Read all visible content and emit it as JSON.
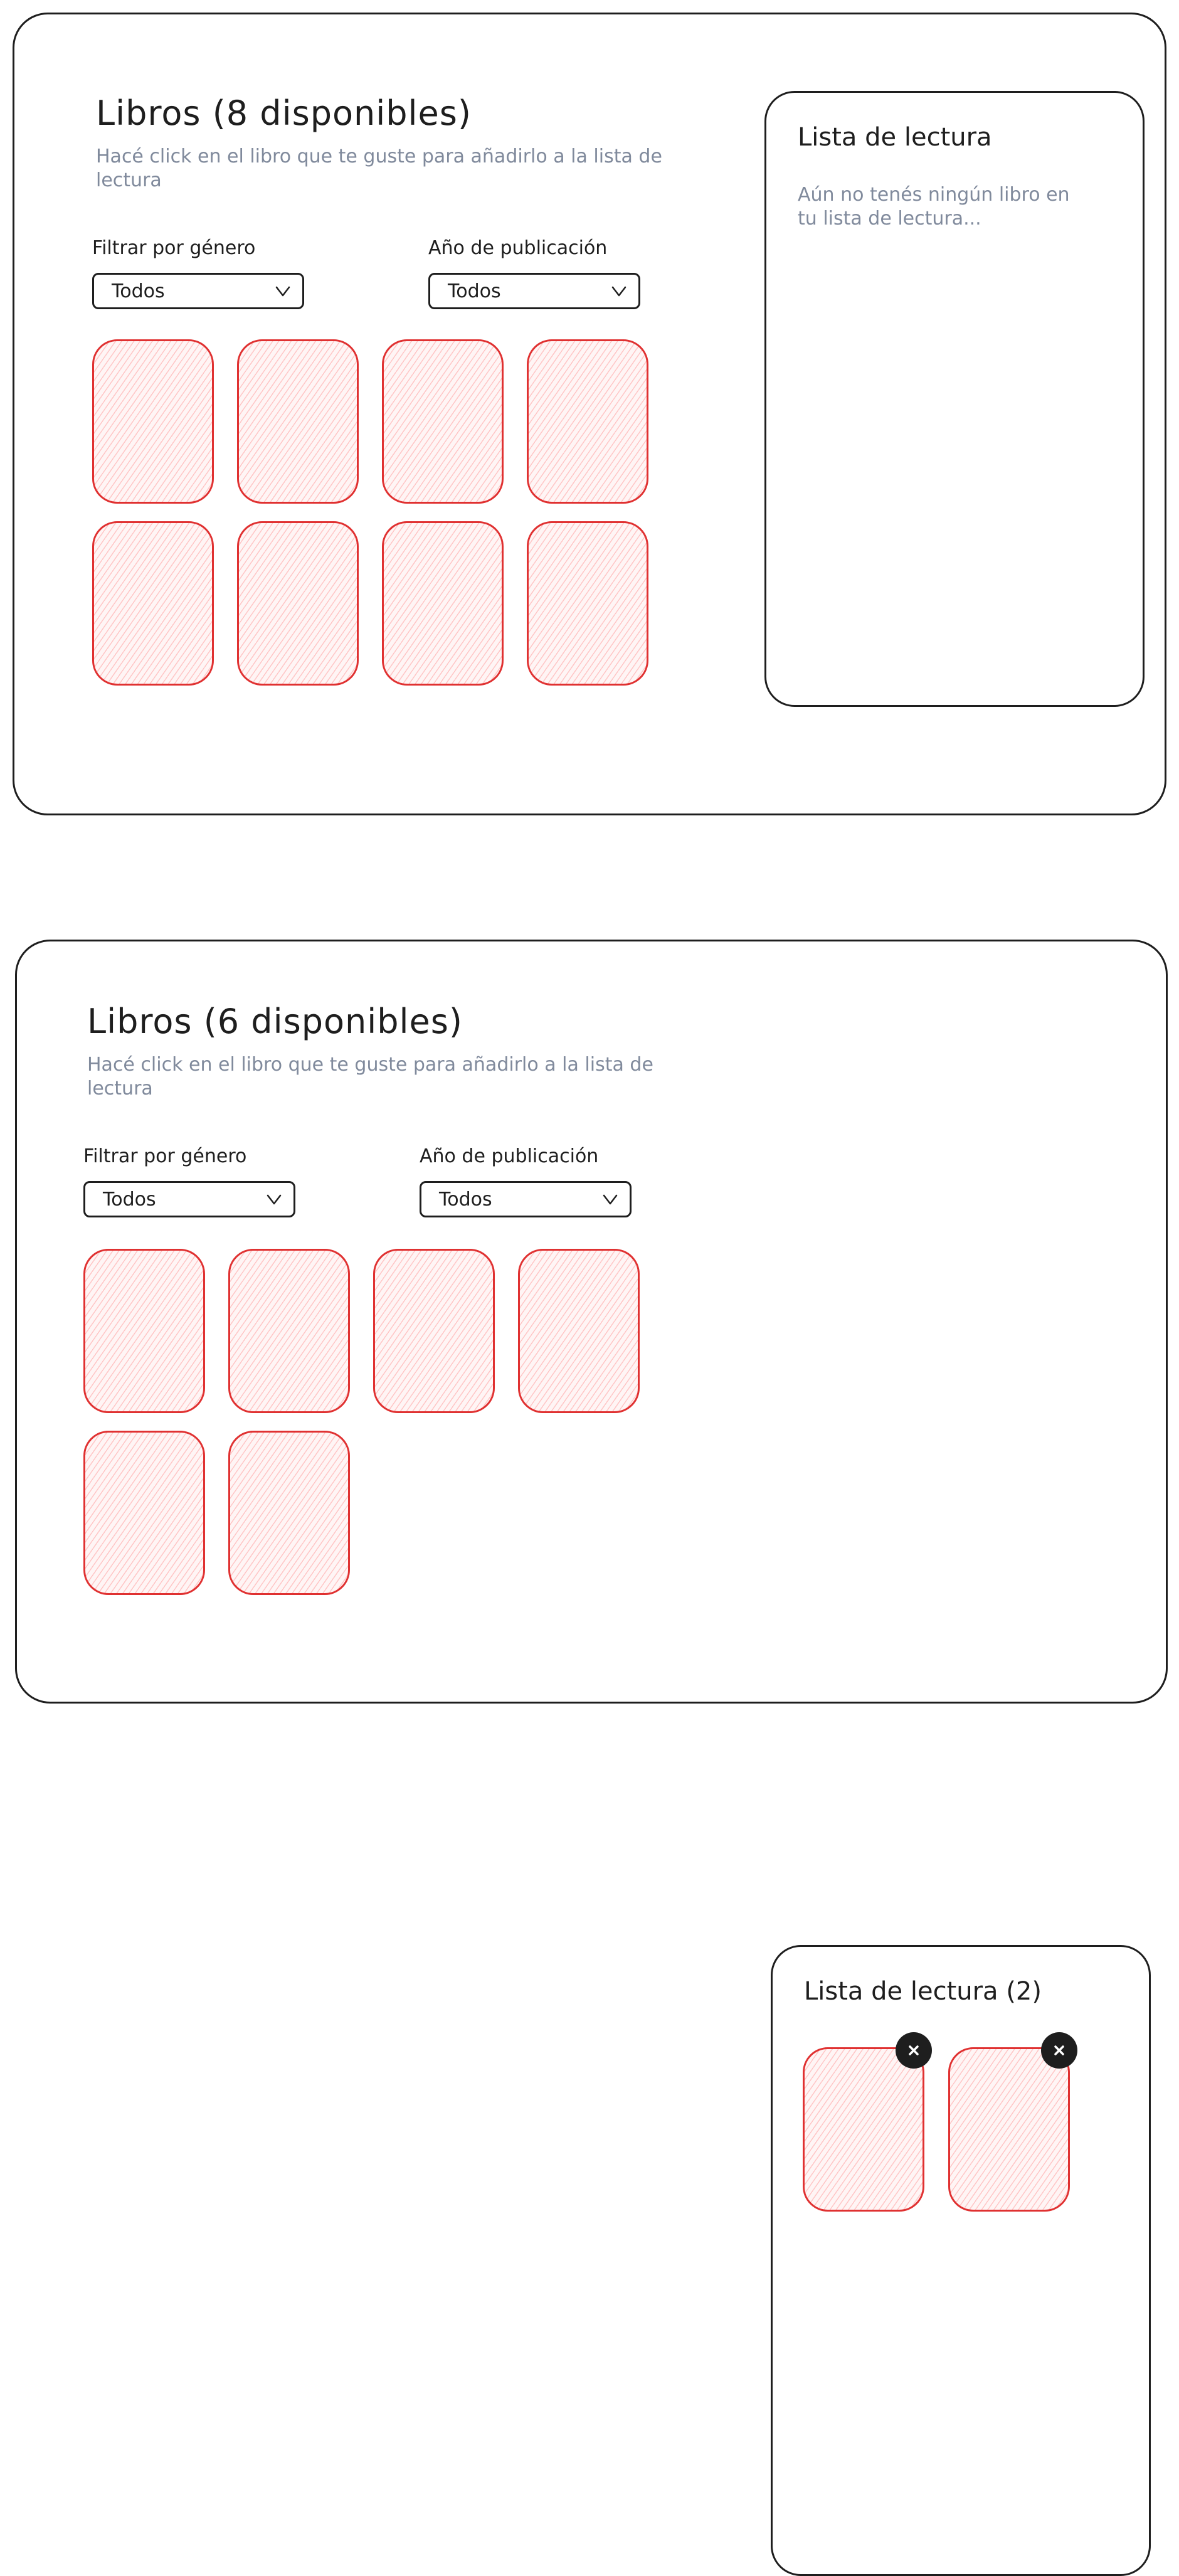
{
  "screens": [
    {
      "title": "Libros (8 disponibles)",
      "subtitle": "Hacé click en el libro que te guste para añadirlo a la lista de lectura",
      "filters": {
        "genre_label": "Filtrar por género",
        "genre_value": "Todos",
        "year_label": "Año de publicación",
        "year_value": "Todos",
        "dropdown_icon": "chevron-down-icon"
      },
      "book_count": 8,
      "reading_list": {
        "title": "Lista de lectura",
        "empty_message": "Aún no tenés ningún libro en tu lista de lectura..."
      }
    },
    {
      "title": "Libros (6 disponibles)",
      "subtitle": "Hacé click en el libro que te guste para añadirlo a la lista de lectura",
      "filters": {
        "genre_label": "Filtrar por género",
        "genre_value": "Todos",
        "year_label": "Año de publicación",
        "year_value": "Todos",
        "dropdown_icon": "chevron-down-icon"
      },
      "book_count": 6,
      "reading_list": {
        "title": "Lista de lectura (2)",
        "item_count": 2,
        "remove_icon": "close-icon"
      }
    }
  ],
  "colors": {
    "ink": "#1e1e1e",
    "muted_text": "#808a9c",
    "book_stroke": "#e03131",
    "book_fill": "#ffc9c9"
  }
}
